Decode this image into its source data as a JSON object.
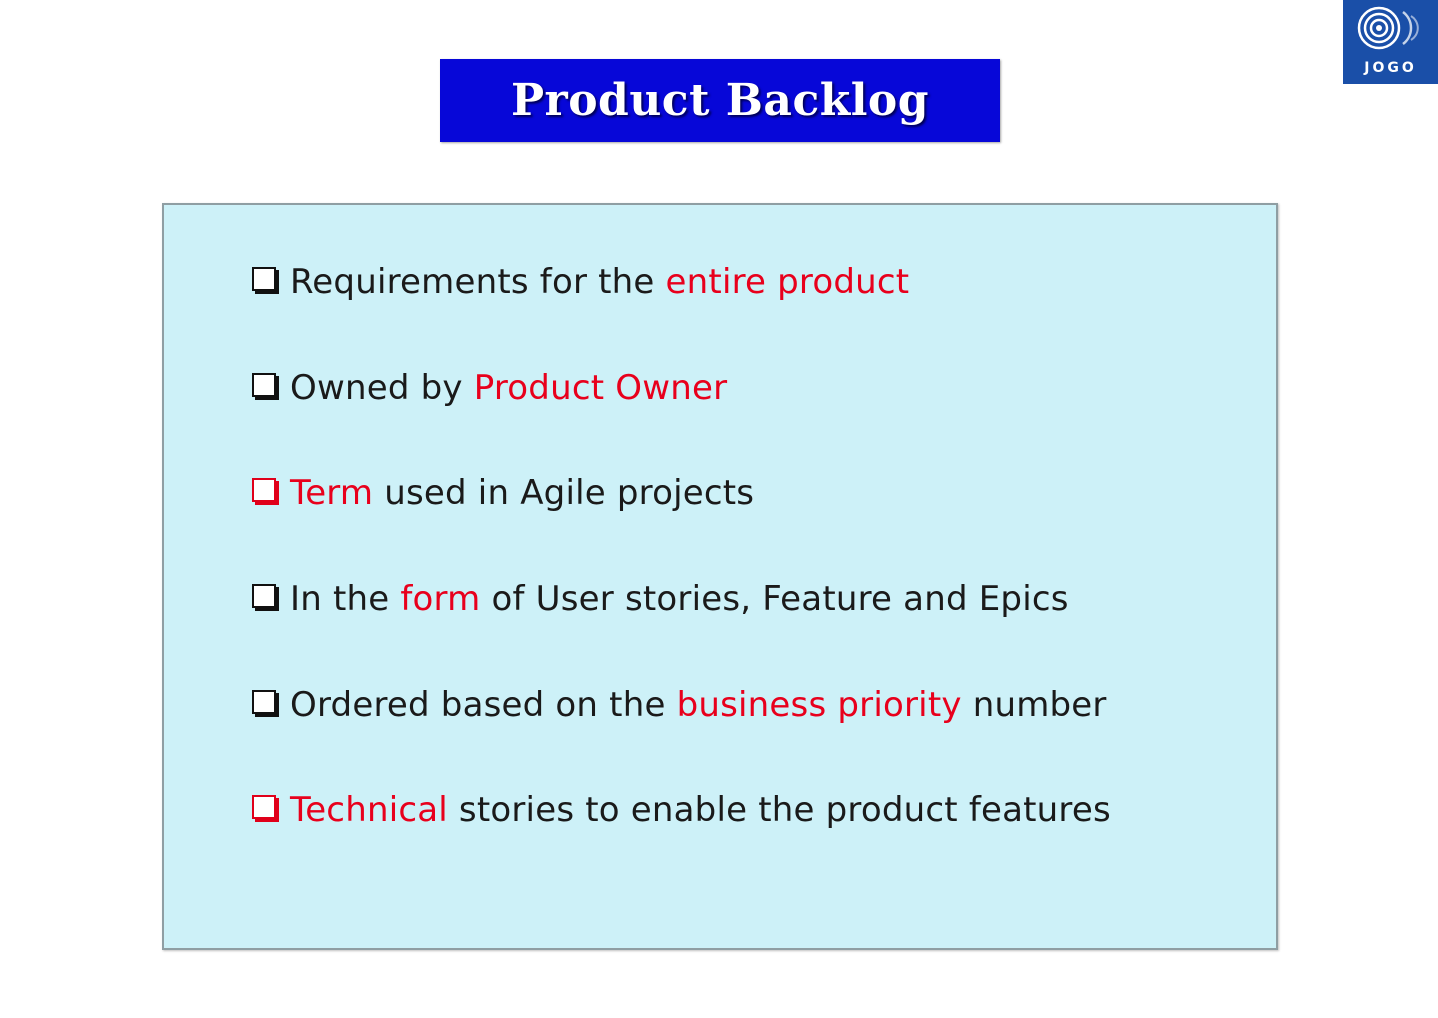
{
  "logo": {
    "text": "JOGO",
    "icon": "concentric-circles-logo-icon",
    "color": "#1a4fa8"
  },
  "slide": {
    "title": "Product Backlog",
    "title_bg": "#0707d8",
    "panel_bg": "#cdf1f8",
    "highlight_color": "#e8001c",
    "items": [
      {
        "checkbox_color": "black",
        "parts": [
          "Requirements for the ",
          "entire product",
          ""
        ]
      },
      {
        "checkbox_color": "black",
        "parts": [
          "Owned by ",
          "Product Owner",
          ""
        ]
      },
      {
        "checkbox_color": "red",
        "parts": [
          "",
          "Term",
          " used in Agile projects"
        ]
      },
      {
        "checkbox_color": "black",
        "parts": [
          "In the ",
          "form",
          " of User stories, Feature and Epics"
        ]
      },
      {
        "checkbox_color": "black",
        "parts": [
          "Ordered based on the ",
          "business priority",
          " number"
        ]
      },
      {
        "checkbox_color": "red",
        "parts": [
          "",
          "Technical",
          " stories to enable the product features"
        ]
      }
    ]
  }
}
